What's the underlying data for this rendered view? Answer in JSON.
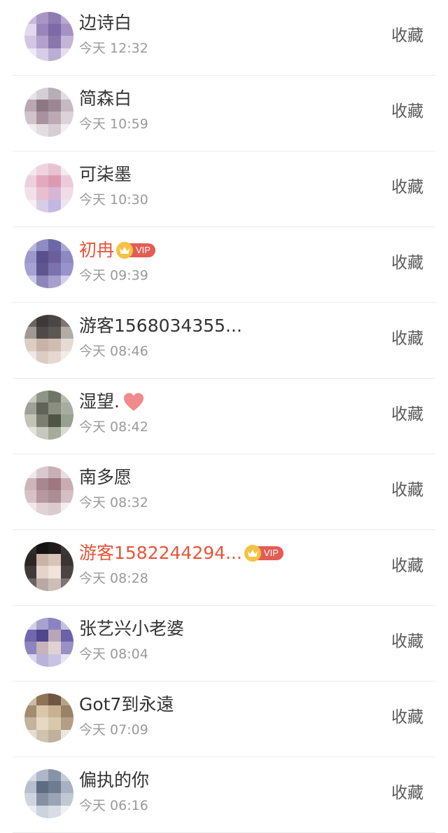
{
  "colors": {
    "vip_name": "#e8543a",
    "name": "#333333",
    "time": "#9a9a9a",
    "action": "#5a5a5a",
    "vip_tag_bg": "#e35d54",
    "crown_bg": "#f5c242",
    "heart": "#f08a8c"
  },
  "items": [
    {
      "name": "边诗白",
      "time": "今天 12:32",
      "action": "收藏",
      "vip": false,
      "heart": false,
      "avatar": [
        "#c9b8d8",
        "#a996c4",
        "#8e7bb0",
        "#b9a8cf",
        "#e2d9ec",
        "#9a86bb",
        "#7d6aa6",
        "#a591c3",
        "#d2c6e3",
        "#b3a1cc",
        "#8a76ad",
        "#c4b5d6",
        "#efe9f4",
        "#d8cde6",
        "#bcaed3",
        "#e6def0"
      ]
    },
    {
      "name": "简森白",
      "time": "今天 10:59",
      "action": "收藏",
      "vip": false,
      "heart": false,
      "avatar": [
        "#e6e4ea",
        "#d4cfd6",
        "#b8aeb8",
        "#e0dce2",
        "#b9a7b1",
        "#8d7783",
        "#9b8793",
        "#c7b8c1",
        "#cfc4cb",
        "#a892a0",
        "#bca9b5",
        "#dcd2d8",
        "#efecef",
        "#e3dde1",
        "#d6ced3",
        "#f2eff1"
      ]
    },
    {
      "name": "可柒墨",
      "time": "今天 10:30",
      "action": "收藏",
      "vip": false,
      "heart": false,
      "avatar": [
        "#f4e8ee",
        "#efd4df",
        "#e9c2d2",
        "#f6eaf0",
        "#ecd0dc",
        "#e3aabf",
        "#dc9ab2",
        "#eccbd8",
        "#f2e0e8",
        "#e8bfcf",
        "#d8b5d5",
        "#f0dce6",
        "#f6eef2",
        "#d8cde7",
        "#c3b8e0",
        "#ede6f2"
      ]
    },
    {
      "name": "初冉",
      "time": "今天 09:39",
      "action": "收藏",
      "vip": true,
      "heart": false,
      "vip_label": "VIP",
      "avatar": [
        "#b8b6d9",
        "#8f8cc4",
        "#6c68a8",
        "#a9a6d2",
        "#9c98cc",
        "#5a4f8d",
        "#6a5f9a",
        "#8c88c2",
        "#a6a2d3",
        "#5f5690",
        "#7a73ad",
        "#9993ca",
        "#cbc9e6",
        "#8e86b8",
        "#a7a0cc",
        "#d2cfe8"
      ]
    },
    {
      "name": "游客1568034355...",
      "time": "今天 08:46",
      "action": "收藏",
      "vip": false,
      "heart": false,
      "avatar": [
        "#6b6561",
        "#3e3a38",
        "#4a4643",
        "#7d7671",
        "#a09893",
        "#4f4a47",
        "#5d5754",
        "#b3aba5",
        "#dccdc5",
        "#c9b3a8",
        "#d1bcb1",
        "#e6dad3",
        "#efe7e2",
        "#dccdc4",
        "#e5d8d0",
        "#f3ede9"
      ]
    },
    {
      "name": "湿望.",
      "time": "今天 08:42",
      "action": "收藏",
      "vip": false,
      "heart": true,
      "avatar": [
        "#c9cbc2",
        "#8f9488",
        "#6f7567",
        "#b7bbae",
        "#9ea195",
        "#5f6456",
        "#8a8e80",
        "#a9ad9f",
        "#c3c4b6",
        "#7b7f70",
        "#4f5445",
        "#98a08e",
        "#e2e3dc",
        "#c6c8bd",
        "#a7ab9c",
        "#d9dbd2"
      ]
    },
    {
      "name": "南多愿",
      "time": "今天 08:32",
      "action": "收藏",
      "vip": false,
      "heart": false,
      "avatar": [
        "#efe7e9",
        "#d9c8cd",
        "#c7b1b7",
        "#e8dde0",
        "#cdb5bc",
        "#a78790",
        "#9d7880",
        "#c9acb3",
        "#d6c2c7",
        "#b698a0",
        "#ad8d95",
        "#d3bfc5",
        "#f0e9eb",
        "#e0d2d6",
        "#dacbd0",
        "#f3eeef"
      ]
    },
    {
      "name": "游客1582244294...",
      "time": "今天 08:28",
      "action": "收藏",
      "vip": true,
      "heart": false,
      "vip_label": "VIP",
      "avatar": [
        "#2f2c2b",
        "#151312",
        "#1e1b1a",
        "#3c3836",
        "#2a2624",
        "#c9b2a6",
        "#d8c4b8",
        "#3a3533",
        "#40393a",
        "#e3d3ca",
        "#efe3dc",
        "#4b4444",
        "#6a6362",
        "#b8aaa3",
        "#cdbfb8",
        "#7c7574"
      ]
    },
    {
      "name": "张艺兴小老婆",
      "time": "今天 08:04",
      "action": "收藏",
      "vip": false,
      "heart": false,
      "avatar": [
        "#d3d0e6",
        "#a8a2cf",
        "#8b83bf",
        "#c5c0e0",
        "#7067ad",
        "#4f468e",
        "#b8a6b6",
        "#6a61a8",
        "#8d84c0",
        "#c7b3b9",
        "#e1d2d3",
        "#9990c6",
        "#dad7ec",
        "#b9b3da",
        "#c8c3e2",
        "#e6e4f2"
      ]
    },
    {
      "name": "Got7到永遠",
      "time": "今天 07:09",
      "action": "收藏",
      "vip": false,
      "heart": false,
      "avatar": [
        "#cbbba4",
        "#8e7457",
        "#6e5742",
        "#b8a388",
        "#a48c70",
        "#d9c6ab",
        "#c7b191",
        "#9a8266",
        "#c2b39c",
        "#e6d8c2",
        "#d8c8ae",
        "#b3a084",
        "#e4ddd1",
        "#cfc3b0",
        "#bfb19a",
        "#ece6dc"
      ]
    },
    {
      "name": "偏执的你",
      "time": "今天 06:16",
      "action": "收藏",
      "vip": false,
      "heart": false,
      "avatar": [
        "#d6dbe3",
        "#aeb7c6",
        "#8794a8",
        "#c5ccd8",
        "#b5bfcd",
        "#5e6b80",
        "#6f7b8f",
        "#a7b1c1",
        "#cfd5de",
        "#8591a3",
        "#9aa4b4",
        "#c0c8d3",
        "#e9ecf0",
        "#cdd3dc",
        "#d8dde4",
        "#eff1f4"
      ]
    }
  ]
}
